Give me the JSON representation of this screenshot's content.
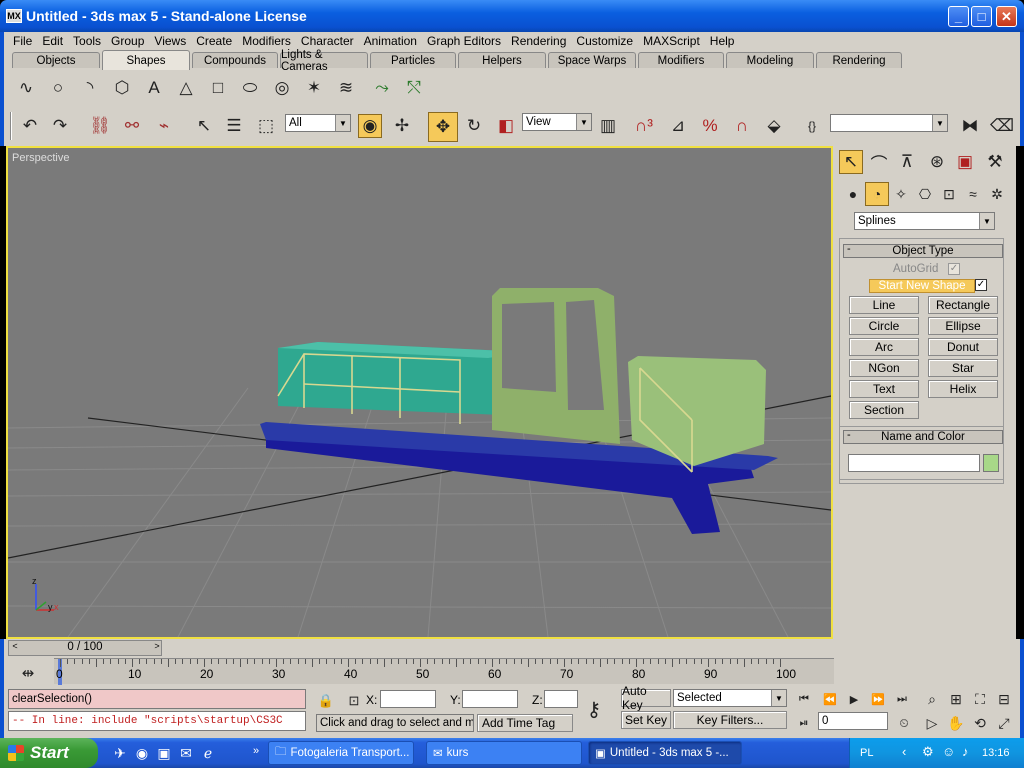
{
  "window": {
    "title": "Untitled - 3ds max 5 - Stand-alone License",
    "app_icon": "MX"
  },
  "menu": [
    "File",
    "Edit",
    "Tools",
    "Group",
    "Views",
    "Create",
    "Modifiers",
    "Character",
    "Animation",
    "Graph Editors",
    "Rendering",
    "Customize",
    "MAXScript",
    "Help"
  ],
  "tabs": [
    "Objects",
    "Shapes",
    "Compounds",
    "Lights & Cameras",
    "Particles",
    "Helpers",
    "Space Warps",
    "Modifiers",
    "Modeling",
    "Rendering"
  ],
  "active_tab": "Shapes",
  "main_toolbar": {
    "selection_filter": "All",
    "ref_coord": "View",
    "named_selection": ""
  },
  "viewport": {
    "label": "Perspective",
    "axis_z": "z",
    "axis_x": "x",
    "axis_y": "y"
  },
  "command_panel": {
    "category": "Splines",
    "object_type_header": "Object Type",
    "autogrid_label": "AutoGrid",
    "start_new_shape_label": "Start New Shape",
    "buttons": [
      "Line",
      "Rectangle",
      "Circle",
      "Ellipse",
      "Arc",
      "Donut",
      "NGon",
      "Star",
      "Text",
      "Helix",
      "Section"
    ],
    "name_color_header": "Name and Color",
    "name_value": "",
    "object_color": "#a8d888"
  },
  "timeline": {
    "slider_label": "0 / 100",
    "ticks": [
      "0",
      "10",
      "20",
      "30",
      "40",
      "50",
      "60",
      "70",
      "80",
      "90",
      "100"
    ]
  },
  "status": {
    "listener_input": "clearSelection()",
    "listener_output": "-- In line: include \"scripts\\startup\\CS3C",
    "x_label": "X:",
    "y_label": "Y:",
    "z_label": "Z:",
    "x_value": "",
    "y_value": "",
    "z_value": "",
    "prompt": "Click and drag to select and mo",
    "add_time_tag": "Add Time Tag",
    "auto_key": "Auto Key",
    "set_key": "Set Key",
    "selected": "Selected",
    "key_filters": "Key Filters...",
    "frame": "0"
  },
  "taskbar": {
    "start": "Start",
    "items": [
      "Fotogaleria Transport...",
      "kurs",
      "Untitled - 3ds max 5 -..."
    ],
    "lang": "PL",
    "clock": "13:16"
  },
  "colors": {
    "accent": "#0a50d0",
    "viewport_border": "#f0e040",
    "highlight": "#f5c95a"
  }
}
